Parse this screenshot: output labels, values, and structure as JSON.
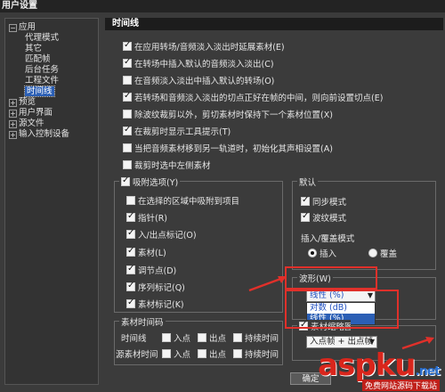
{
  "window": {
    "title": "用户设置"
  },
  "tree": {
    "items": [
      {
        "label": "应用",
        "expander": "−",
        "selected": false
      },
      {
        "label": "代理模式",
        "selected": false
      },
      {
        "label": "其它",
        "selected": false
      },
      {
        "label": "匹配帧",
        "selected": false
      },
      {
        "label": "后台任务",
        "selected": false
      },
      {
        "label": "工程文件",
        "selected": false
      },
      {
        "label": "时间线",
        "selected": true
      },
      {
        "label": "预览",
        "expander": "+",
        "selected": false
      },
      {
        "label": "用户界面",
        "expander": "+",
        "selected": false
      },
      {
        "label": "源文件",
        "expander": "+",
        "selected": false
      },
      {
        "label": "输入控制设备",
        "expander": "+",
        "selected": false
      }
    ]
  },
  "panel": {
    "header": "时间线",
    "options": [
      {
        "label": "在应用转场/音频淡入淡出时延展素材(E)",
        "checked": true
      },
      {
        "label": "在转场中插入默认的音频淡入淡出(C)",
        "checked": true
      },
      {
        "label": "在音频淡入淡出中插入默认的转场(O)",
        "checked": false
      },
      {
        "label": "若转场和音频淡入淡出的切点正好在帧的中间，则向前设置切点(E)",
        "checked": true
      },
      {
        "label": "除波纹裁剪以外，剪切素材时保持下一个素材位置(X)",
        "checked": false
      },
      {
        "label": "在裁剪时显示工具提示(T)",
        "checked": true
      },
      {
        "label": "当把音频素材移到另一轨道时，初始化其声相设置(A)",
        "checked": false
      },
      {
        "label": "裁剪时选中左侧素材",
        "checked": false
      }
    ],
    "snap": {
      "title": "吸附选项(Y)",
      "checked": true,
      "items": [
        {
          "label": "在选择的区域中吸附到项目",
          "checked": false
        },
        {
          "label": "指针(R)",
          "checked": true
        },
        {
          "label": "入/出点标记(O)",
          "checked": true
        },
        {
          "label": "素材(L)",
          "checked": true
        },
        {
          "label": "调节点(D)",
          "checked": true
        },
        {
          "label": "序列标记(Q)",
          "checked": true
        },
        {
          "label": "素材标记(K)",
          "checked": true
        }
      ]
    },
    "defaults": {
      "title": "默认",
      "sync_label": "同步模式",
      "sync_checked": true,
      "ripple_label": "波纹模式",
      "ripple_checked": true,
      "insert_mode_label": "插入/覆盖模式",
      "insert_label": "插入",
      "insert_selected": true,
      "overwrite_label": "覆盖",
      "overwrite_selected": false
    },
    "waveform": {
      "title": "波形(W)",
      "selected": "线性 (%)",
      "options": [
        "对数 (dB)",
        "线性 (%)"
      ],
      "highlighted_index": 1
    },
    "thumb": {
      "title_partial": "素材缩略图(B)",
      "checked": true,
      "selected": "入点帧 + 出点帧"
    },
    "timecode": {
      "title": "素材时间码",
      "rows": [
        {
          "label": "时间线",
          "in": "入点",
          "out": "出点",
          "duration": "持续时间"
        },
        {
          "label": "源素材时间",
          "in": "入点",
          "out": "出点",
          "duration": "持续时间"
        }
      ]
    },
    "ok_button": "确定"
  },
  "watermark": {
    "main": "aspku",
    "suffix": ".net",
    "sub": "免费网站源码下载站"
  },
  "colors": {
    "highlight": "#2b5fb5",
    "annotation": "#e0302a"
  }
}
